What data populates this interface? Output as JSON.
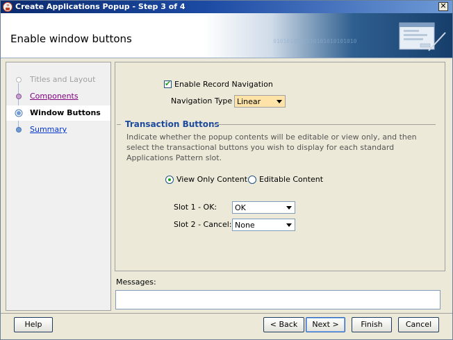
{
  "window": {
    "title": "Create Applications Popup - Step 3 of 4",
    "close_label": "✕"
  },
  "header": {
    "title": "Enable window buttons",
    "decor_text": "0101010101010101010101010"
  },
  "nav": {
    "items": [
      {
        "label": "Titles and Layout",
        "state": "disabled"
      },
      {
        "label": "Components",
        "state": "visited"
      },
      {
        "label": "Window Buttons",
        "state": "current"
      },
      {
        "label": "Summary",
        "state": "link"
      }
    ]
  },
  "form": {
    "enable_record_navigation": {
      "label": "Enable Record Navigation",
      "checked": true
    },
    "navigation_type": {
      "label": "Navigation Type",
      "value": "Linear"
    },
    "transaction_section": {
      "title": "Transaction Buttons",
      "description": "Indicate whether the popup contents will be editable or view only, and then select the transactional buttons you wish to display for each standard Applications Pattern slot."
    },
    "content_mode": {
      "view_only_label": "View Only Content",
      "editable_label": "Editable Content",
      "selected": "view_only"
    },
    "slot1": {
      "label": "Slot 1 - OK:",
      "value": "OK"
    },
    "slot2": {
      "label": "Slot 2 - Cancel:",
      "value": "None"
    }
  },
  "messages": {
    "label": "Messages:"
  },
  "buttons": {
    "help": "Help",
    "back": "< Back",
    "next": "Next >",
    "finish": "Finish",
    "cancel": "Cancel"
  },
  "colors": {
    "titlebar": "#1c4aa3",
    "section_title": "#1c4a9c",
    "visited_link": "#800080",
    "link": "#0033cc",
    "check_accent": "#21a121",
    "combo_highlight": "#fde3a7"
  }
}
